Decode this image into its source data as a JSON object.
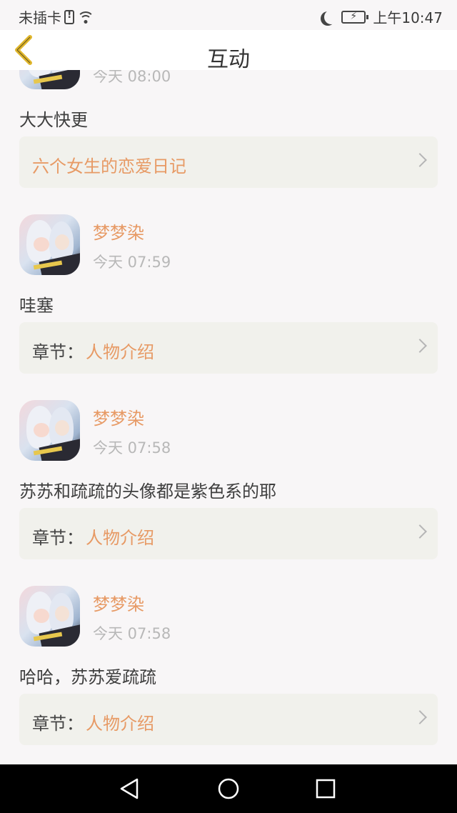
{
  "status_bar": {
    "carrier": "未插卡",
    "time": "上午10:47"
  },
  "header": {
    "title": "互动"
  },
  "comments": [
    {
      "username": "",
      "time": "今天 08:00",
      "text": "大大快更",
      "ref_prefix": "",
      "ref_title": "六个女生的恋爱日记"
    },
    {
      "username": "梦梦染",
      "time": "今天 07:59",
      "text": "哇塞",
      "ref_prefix": "章节：",
      "ref_title": "人物介绍"
    },
    {
      "username": "梦梦染",
      "time": "今天 07:58",
      "text": "苏苏和疏疏的头像都是紫色系的耶",
      "ref_prefix": "章节：",
      "ref_title": "人物介绍"
    },
    {
      "username": "梦梦染",
      "time": "今天 07:58",
      "text": "哈哈，苏苏爱疏疏",
      "ref_prefix": "章节：",
      "ref_title": "人物介绍"
    }
  ],
  "colors": {
    "accent": "#e79a65",
    "back_arrow": "#e0b62c",
    "card_bg": "#f1f1ec"
  }
}
